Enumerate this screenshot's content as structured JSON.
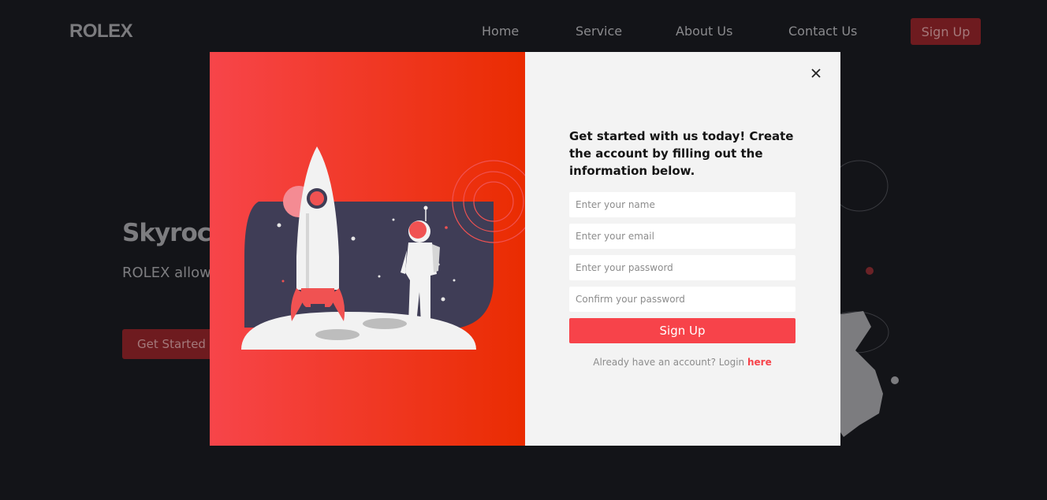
{
  "brand": {
    "logo": "ROLEX"
  },
  "nav": {
    "items": [
      {
        "label": "Home"
      },
      {
        "label": "Service"
      },
      {
        "label": "About Us"
      },
      {
        "label": "Contact Us"
      }
    ],
    "signup_label": "Sign Up"
  },
  "hero": {
    "title": "Skyrock",
    "text": "ROLEX allow business. So",
    "cta_label": "Get Started"
  },
  "modal": {
    "heading": "Get started with us today! Create the account by filling out the information below.",
    "fields": {
      "name": {
        "placeholder": "Enter your name",
        "value": ""
      },
      "email": {
        "placeholder": "Enter your email",
        "value": ""
      },
      "password": {
        "placeholder": "Enter your password",
        "value": ""
      },
      "confirm": {
        "placeholder": "Confirm your password",
        "value": ""
      }
    },
    "submit_label": "Sign Up",
    "login_prompt": "Already have an account? Login",
    "login_link": "here",
    "close_icon": "close-icon"
  },
  "colors": {
    "page_bg": "#131418",
    "accent": "#f7434a",
    "gradient_start": "#f7454a",
    "gradient_end": "#ea2c01",
    "panel_bg": "#f3f3f3",
    "dim_button": "#6e1b1f"
  }
}
